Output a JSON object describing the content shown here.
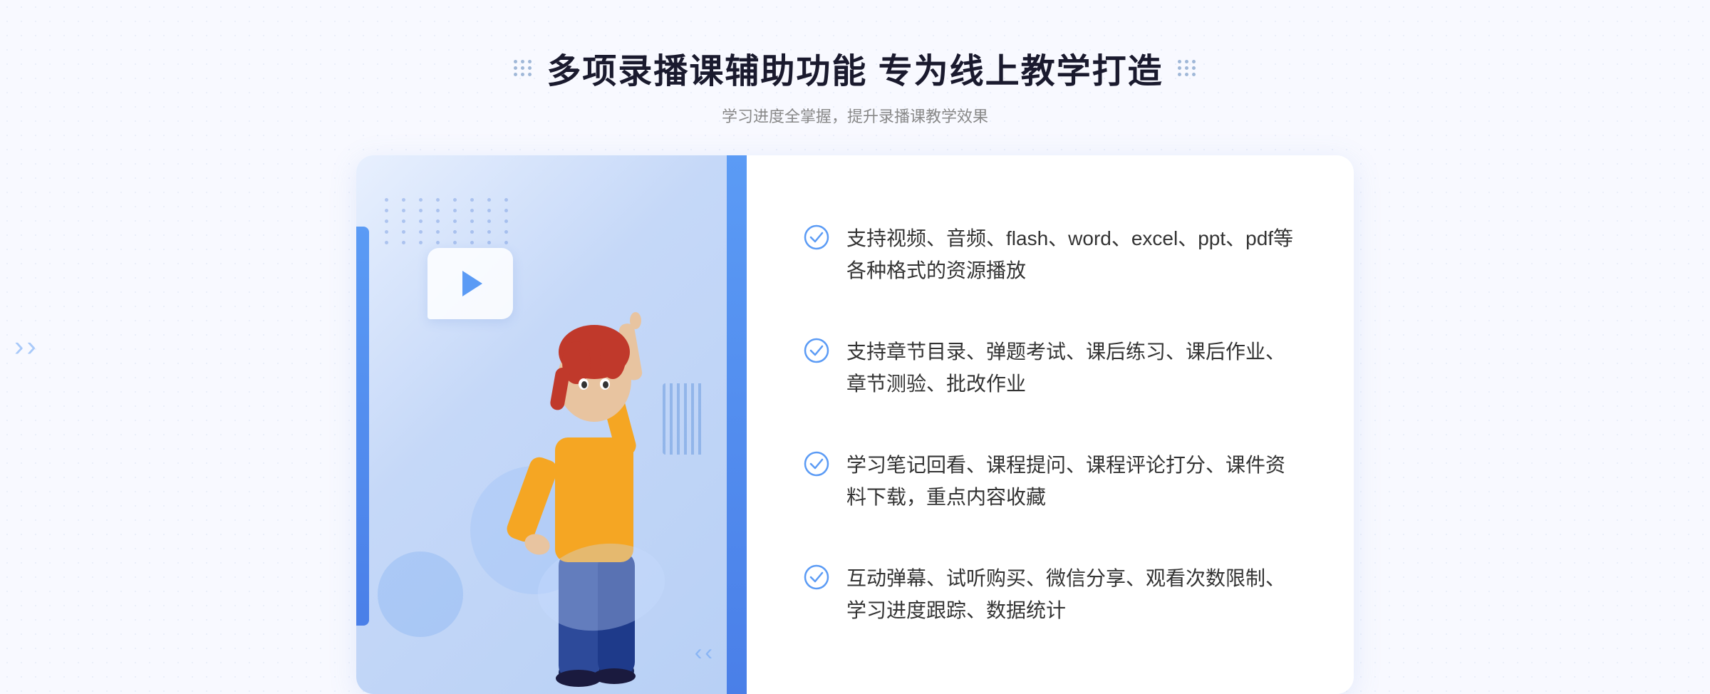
{
  "header": {
    "title": "多项录播课辅助功能 专为线上教学打造",
    "subtitle": "学习进度全掌握，提升录播课教学效果"
  },
  "features": [
    {
      "id": "feature-1",
      "text": "支持视频、音频、flash、word、excel、ppt、pdf等各种格式的资源播放"
    },
    {
      "id": "feature-2",
      "text": "支持章节目录、弹题考试、课后练习、课后作业、章节测验、批改作业"
    },
    {
      "id": "feature-3",
      "text": "学习笔记回看、课程提问、课程评论打分、课件资料下载，重点内容收藏"
    },
    {
      "id": "feature-4",
      "text": "互动弹幕、试听购买、微信分享、观看次数限制、学习进度跟踪、数据统计"
    }
  ],
  "icons": {
    "check": "check-circle-icon",
    "play": "play-icon",
    "left_arrows": "left-arrows-icon"
  },
  "colors": {
    "primary": "#4a7fe8",
    "primary_light": "#5b9bf5",
    "text_dark": "#1a1a2e",
    "text_medium": "#333333",
    "text_light": "#888888",
    "accent_bar": "#4a7fe8",
    "check_color": "#5b9bf5"
  }
}
